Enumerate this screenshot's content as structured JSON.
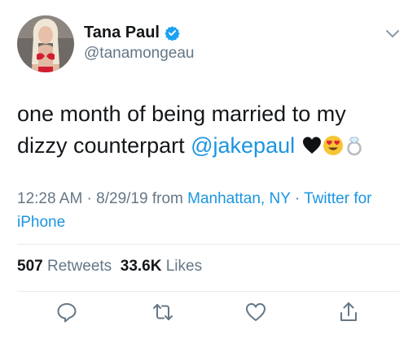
{
  "author": {
    "name": "Tana Paul",
    "handle": "@tanamongeau"
  },
  "tweet": {
    "text_before": "one month of being married to my dizzy counterpart ",
    "mention": "@jakepaul",
    "emojis": [
      "black-heart-icon",
      "heart-eyes-icon",
      "ring-icon"
    ]
  },
  "meta": {
    "time": "12:28 AM",
    "sep1": " · ",
    "date": "8/29/19",
    "from": " from ",
    "location": "Manhattan, NY",
    "sep2": " · ",
    "source": "Twitter for iPhone"
  },
  "stats": {
    "retweets_count": "507",
    "retweets_label": "Retweets",
    "likes_count": "33.6K",
    "likes_label": "Likes"
  },
  "colors": {
    "link": "#1b95e0",
    "secondary": "#657786",
    "text": "#14171a",
    "divider": "#e6ecf0"
  }
}
